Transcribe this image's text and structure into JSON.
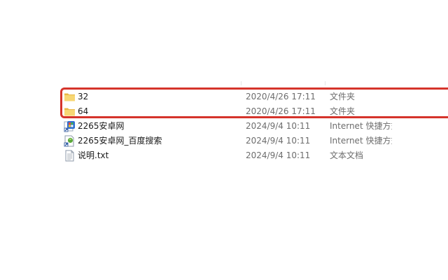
{
  "files": [
    {
      "name": "32",
      "date": "2020/4/26 17:11",
      "type": "文件夹",
      "icon": "folder-icon"
    },
    {
      "name": "64",
      "date": "2020/4/26 17:11",
      "type": "文件夹",
      "icon": "folder-icon"
    },
    {
      "name": "2265安卓网",
      "date": "2024/9/4 10:11",
      "type": "Internet 快捷方式",
      "icon": "internet-shortcut-icon"
    },
    {
      "name": "2265安卓网_百度搜索",
      "date": "2024/9/4 10:11",
      "type": "Internet 快捷方式",
      "icon": "internet-shortcut-icon"
    },
    {
      "name": "说明.txt",
      "date": "2024/9/4 10:11",
      "type": "文本文档",
      "icon": "text-document-icon"
    }
  ],
  "colors": {
    "highlight": "#d5342b",
    "folder": "#f7d774",
    "secondary_text": "#6d6d6d"
  }
}
